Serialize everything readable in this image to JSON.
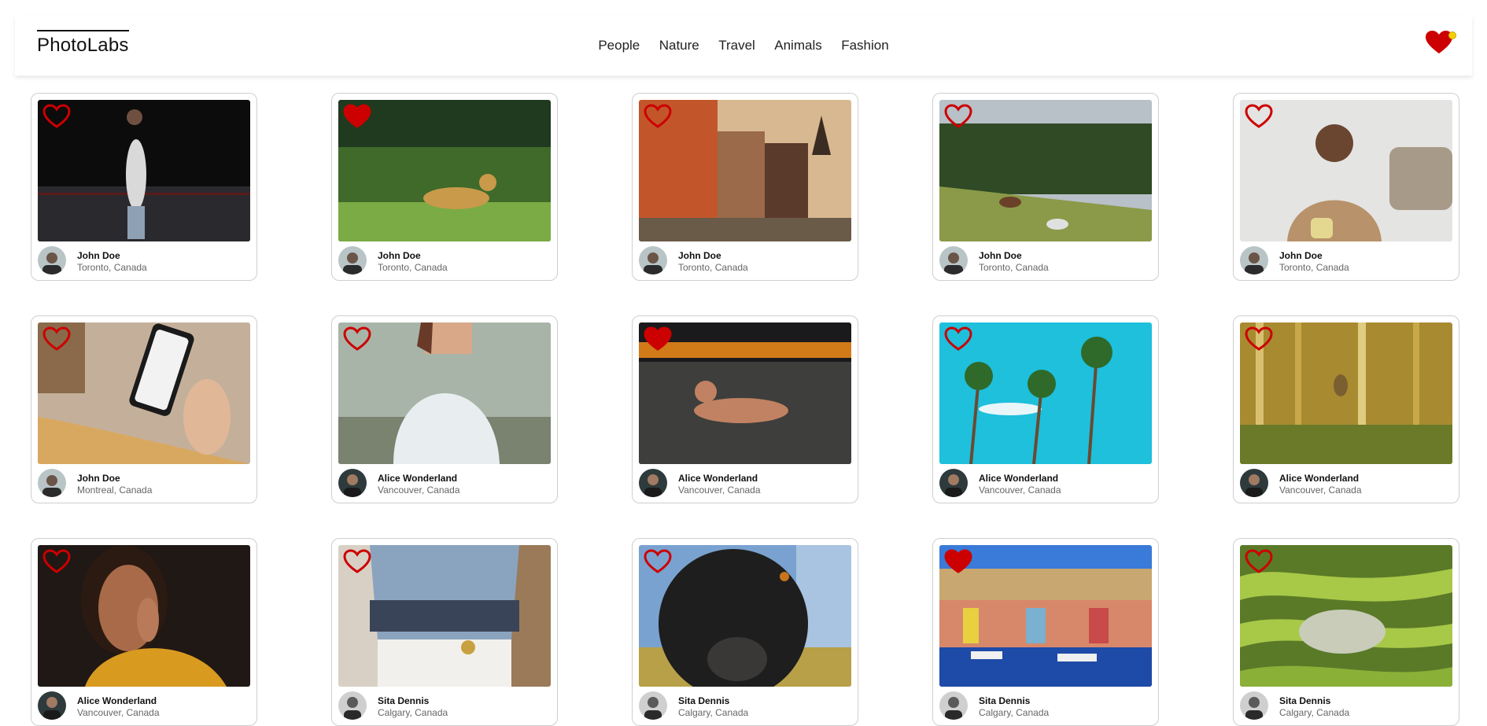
{
  "app": {
    "logo": "PhotoLabs"
  },
  "nav": {
    "topics": [
      "People",
      "Nature",
      "Travel",
      "Animals",
      "Fashion"
    ]
  },
  "colors": {
    "heart": "#cc0000",
    "notification_dot": "#f5d000"
  },
  "photos": [
    {
      "user": "John Doe",
      "location": "Toronto, Canada",
      "liked": false
    },
    {
      "user": "John Doe",
      "location": "Toronto, Canada",
      "liked": true
    },
    {
      "user": "John Doe",
      "location": "Toronto, Canada",
      "liked": false
    },
    {
      "user": "John Doe",
      "location": "Toronto, Canada",
      "liked": false
    },
    {
      "user": "John Doe",
      "location": "Toronto, Canada",
      "liked": false
    },
    {
      "user": "John Doe",
      "location": "Montreal, Canada",
      "liked": false
    },
    {
      "user": "Alice Wonderland",
      "location": "Vancouver, Canada",
      "liked": false
    },
    {
      "user": "Alice Wonderland",
      "location": "Vancouver, Canada",
      "liked": true
    },
    {
      "user": "Alice Wonderland",
      "location": "Vancouver, Canada",
      "liked": false
    },
    {
      "user": "Alice Wonderland",
      "location": "Vancouver, Canada",
      "liked": false
    },
    {
      "user": "Alice Wonderland",
      "location": "Vancouver, Canada",
      "liked": false
    },
    {
      "user": "Sita Dennis",
      "location": "Calgary, Canada",
      "liked": false
    },
    {
      "user": "Sita Dennis",
      "location": "Calgary, Canada",
      "liked": false
    },
    {
      "user": "Sita Dennis",
      "location": "Calgary, Canada",
      "liked": true
    },
    {
      "user": "Sita Dennis",
      "location": "Calgary, Canada",
      "liked": false
    }
  ]
}
